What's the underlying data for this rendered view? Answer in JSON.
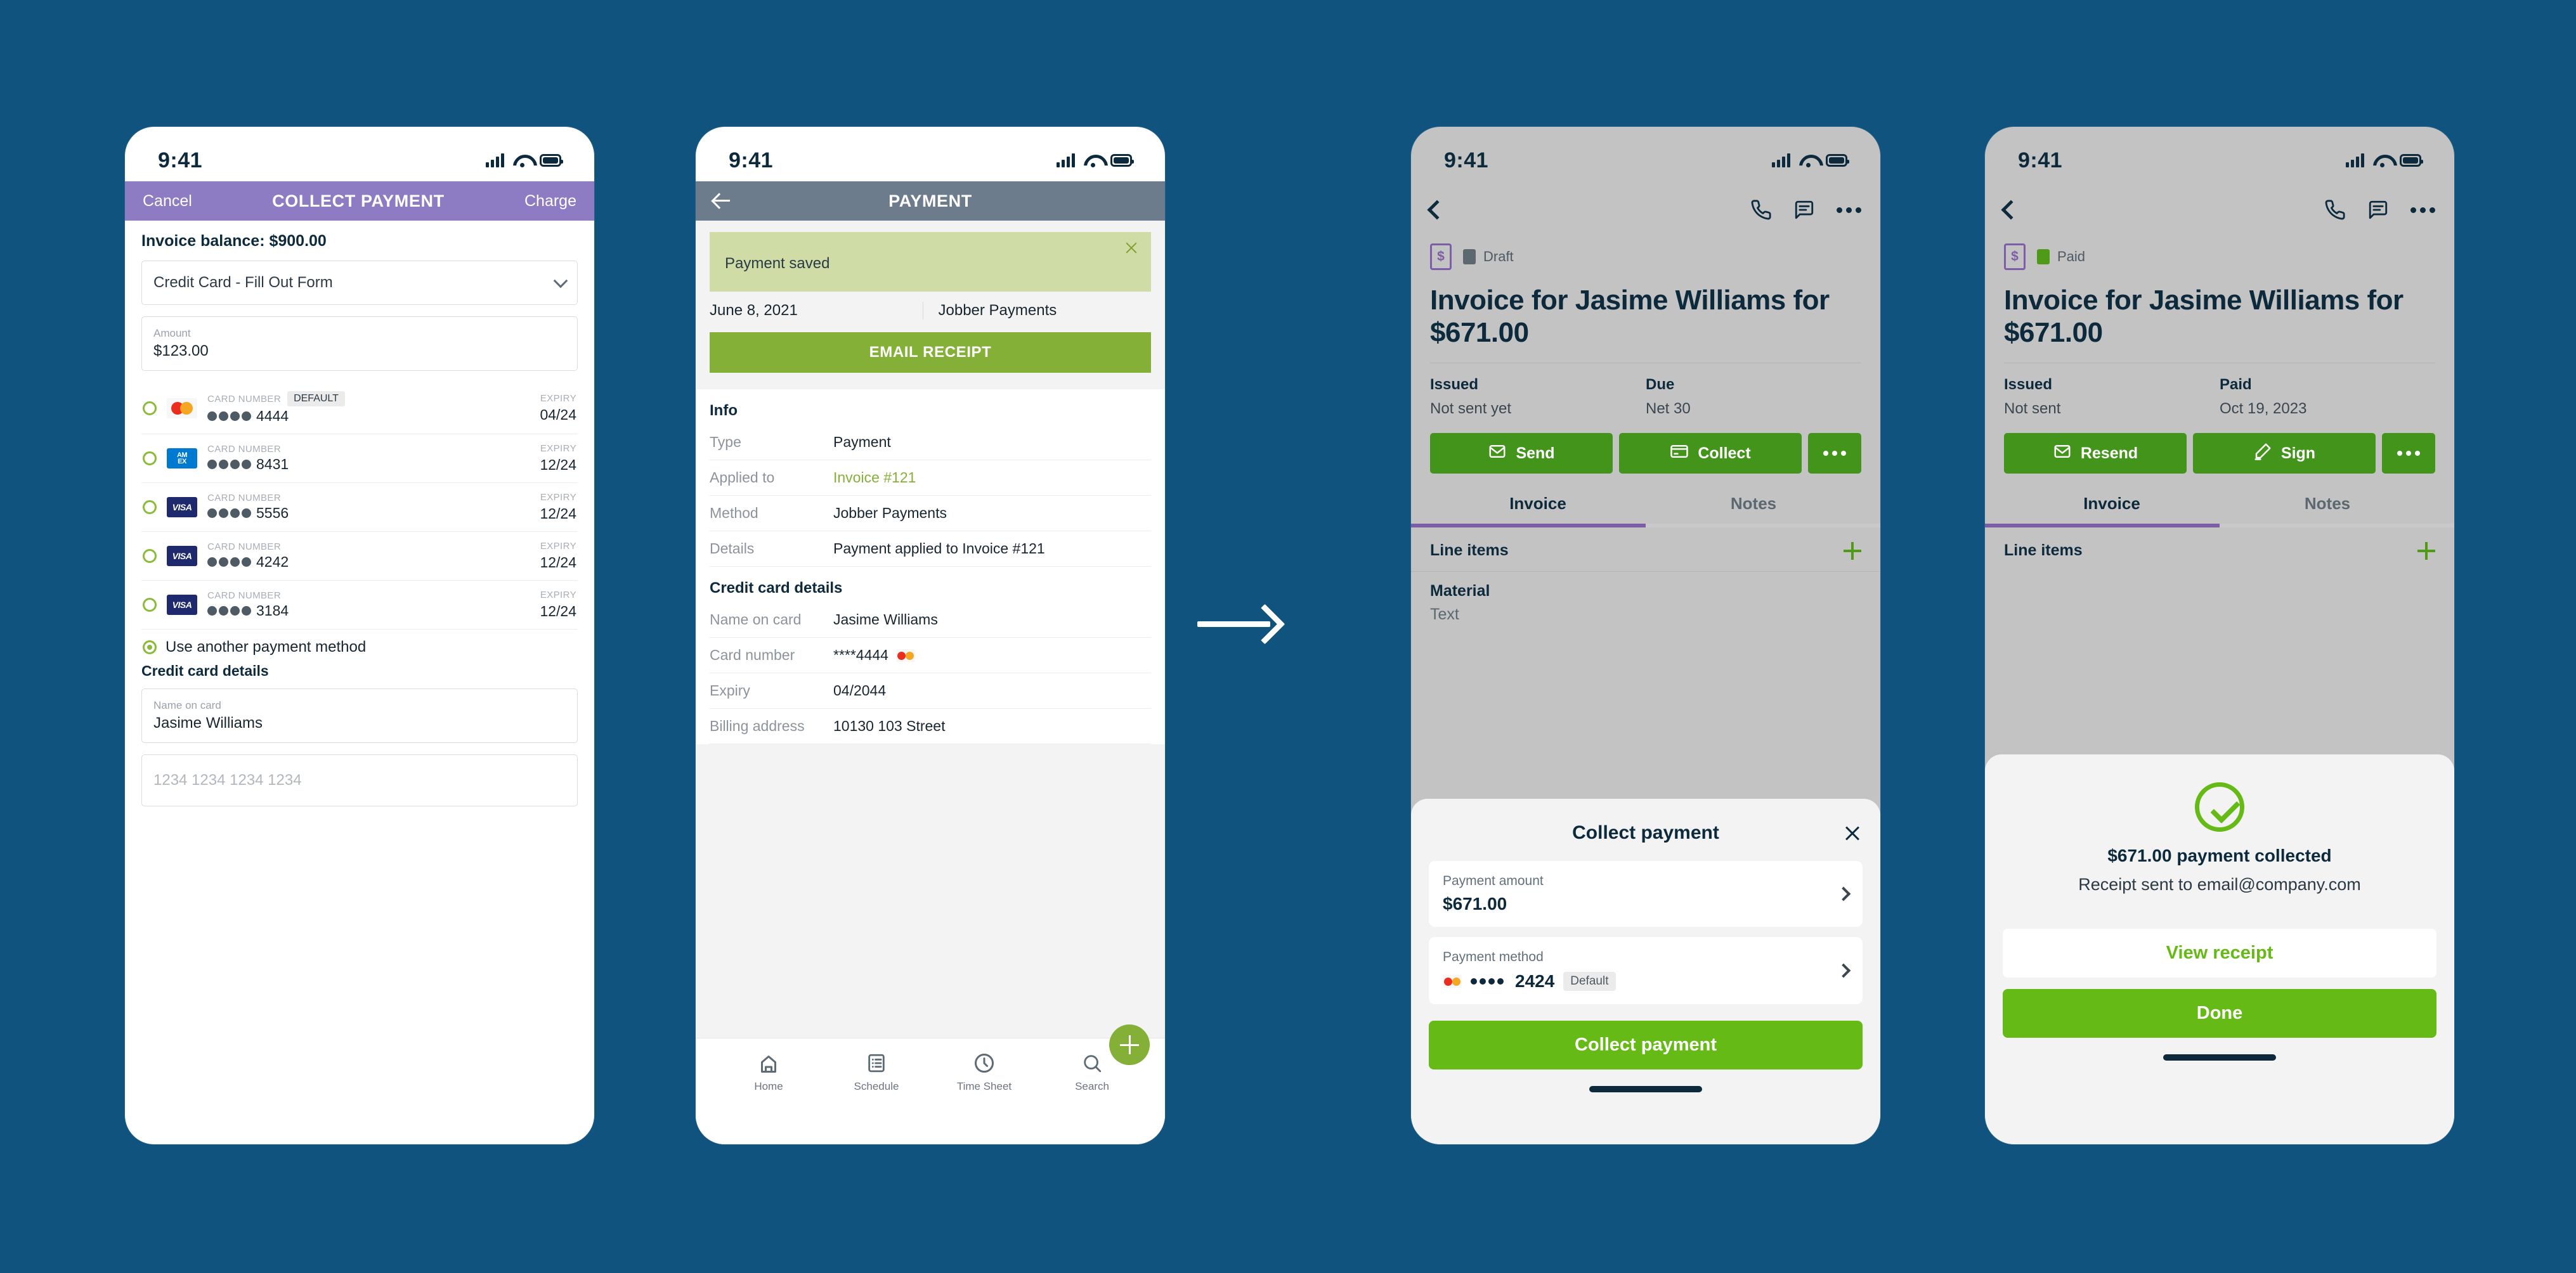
{
  "background_color": "#10537f",
  "accent_colors": {
    "purple": "#8d7cc4",
    "green": "#85b037",
    "bright_green": "#65ba15",
    "slate": "#6d7c8c",
    "navy": "#0d2a3d"
  },
  "status_bar": {
    "time": "9:41",
    "signal_icon": "cellular-signal-icon",
    "wifi_icon": "wifi-icon",
    "battery_icon": "battery-icon"
  },
  "flow_arrow": {
    "icon": "right-arrow-icon"
  },
  "phone1": {
    "header": {
      "cancel_label": "Cancel",
      "title": "COLLECT PAYMENT",
      "charge_label": "Charge"
    },
    "balance_label": "Invoice balance: $900.00",
    "method_select": {
      "value": "Credit Card - Fill Out Form",
      "chevron": "chevron-down-icon"
    },
    "amount_field": {
      "label": "Amount",
      "value": "$123.00"
    },
    "card_caption": "CARD NUMBER",
    "expiry_caption": "EXPIRY",
    "default_badge": "DEFAULT",
    "cards": [
      {
        "brand": "mastercard",
        "brand_text": "",
        "last4": "4444",
        "expiry": "04/24",
        "is_default": true
      },
      {
        "brand": "amex",
        "brand_text": "AM EX",
        "last4": "8431",
        "expiry": "12/24",
        "is_default": false
      },
      {
        "brand": "visa",
        "brand_text": "VISA",
        "last4": "5556",
        "expiry": "12/24",
        "is_default": false
      },
      {
        "brand": "visa",
        "brand_text": "VISA",
        "last4": "4242",
        "expiry": "12/24",
        "is_default": false
      },
      {
        "brand": "visa",
        "brand_text": "VISA",
        "last4": "3184",
        "expiry": "12/24",
        "is_default": false
      }
    ],
    "use_another_label": "Use another payment method",
    "cc_details_heading": "Credit card details",
    "name_field": {
      "label": "Name on card",
      "value": "Jasime Williams"
    },
    "number_field": {
      "placeholder": "1234 1234 1234 1234",
      "value": ""
    }
  },
  "phone2": {
    "header": {
      "back_icon": "back-arrow-icon",
      "title": "PAYMENT"
    },
    "toast": {
      "text": "Payment saved",
      "close_icon": "close-icon"
    },
    "meta": {
      "date": "June 8, 2021",
      "processor": "Jobber Payments"
    },
    "email_receipt_label": "EMAIL RECEIPT",
    "info_heading": "Info",
    "info_rows": [
      {
        "key": "Type",
        "value": "Payment",
        "link": false
      },
      {
        "key": "Applied to",
        "value": "Invoice #121",
        "link": true
      },
      {
        "key": "Method",
        "value": "Jobber Payments",
        "link": false
      },
      {
        "key": "Details",
        "value": "Payment applied to Invoice #121",
        "link": false
      }
    ],
    "cc_heading": "Credit card details",
    "cc_rows": [
      {
        "key": "Name on card",
        "value": "Jasime Williams",
        "brand": ""
      },
      {
        "key": "Card number",
        "value": "****4444",
        "brand": "mastercard"
      },
      {
        "key": "Expiry",
        "value": "04/2044",
        "brand": ""
      },
      {
        "key": "Billing address",
        "value": "10130 103 Street",
        "brand": ""
      }
    ],
    "tabbar": [
      {
        "label": "Home",
        "icon": "home-icon"
      },
      {
        "label": "Schedule",
        "icon": "schedule-list-icon"
      },
      {
        "label": "Time Sheet",
        "icon": "clock-icon"
      },
      {
        "label": "Search",
        "icon": "search-icon"
      }
    ],
    "fab": {
      "icon": "plus-icon"
    }
  },
  "phone3": {
    "nav": {
      "back_icon": "chevron-left-icon",
      "phone_icon": "phone-icon",
      "message_icon": "message-icon",
      "more_icon": "more-horizontal-icon"
    },
    "status": {
      "doc_icon": "invoice-dollar-icon",
      "badge_color": "#5c6870",
      "label": "Draft"
    },
    "title": "Invoice for Jasime Williams for $671.00",
    "cols": [
      {
        "heading": "Issued",
        "value": "Not sent yet"
      },
      {
        "heading": "Due",
        "value": "Net 30"
      }
    ],
    "actions": [
      {
        "label": "Send",
        "icon": "envelope-icon"
      },
      {
        "label": "Collect",
        "icon": "credit-card-icon"
      },
      {
        "label": "",
        "icon": "more-horizontal-icon"
      }
    ],
    "tabs": [
      {
        "label": "Invoice",
        "active": true
      },
      {
        "label": "Notes",
        "active": false
      }
    ],
    "line_items_heading": "Line items",
    "add_icon": "plus-icon",
    "line_item": {
      "title": "Material",
      "subtitle": "Text"
    },
    "sheet": {
      "title": "Collect payment",
      "close_icon": "close-icon",
      "amount": {
        "label": "Payment amount",
        "value": "$671.00",
        "chevron": "chevron-right-icon"
      },
      "method": {
        "label": "Payment method",
        "brand": "mastercard",
        "masked": "2424",
        "badge": "Default",
        "chevron": "chevron-right-icon"
      },
      "cta": "Collect payment"
    }
  },
  "phone4": {
    "nav": {
      "back_icon": "chevron-left-icon",
      "phone_icon": "phone-icon",
      "message_icon": "message-icon",
      "more_icon": "more-horizontal-icon"
    },
    "status": {
      "doc_icon": "invoice-dollar-icon",
      "badge_color": "#4f9a16",
      "label": "Paid"
    },
    "title": "Invoice for Jasime Williams for $671.00",
    "cols": [
      {
        "heading": "Issued",
        "value": "Not sent"
      },
      {
        "heading": "Paid",
        "value": "Oct 19, 2023"
      }
    ],
    "actions": [
      {
        "label": "Resend",
        "icon": "envelope-icon"
      },
      {
        "label": "Sign",
        "icon": "pen-icon"
      },
      {
        "label": "",
        "icon": "more-horizontal-icon"
      }
    ],
    "tabs": [
      {
        "label": "Invoice",
        "active": true
      },
      {
        "label": "Notes",
        "active": false
      }
    ],
    "line_items_heading": "Line items",
    "add_icon": "plus-icon",
    "sheet": {
      "check_icon": "check-circle-icon",
      "title": "$671.00 payment collected",
      "subtitle": "Receipt sent to email@company.com",
      "secondary_cta": "View receipt",
      "primary_cta": "Done"
    }
  }
}
